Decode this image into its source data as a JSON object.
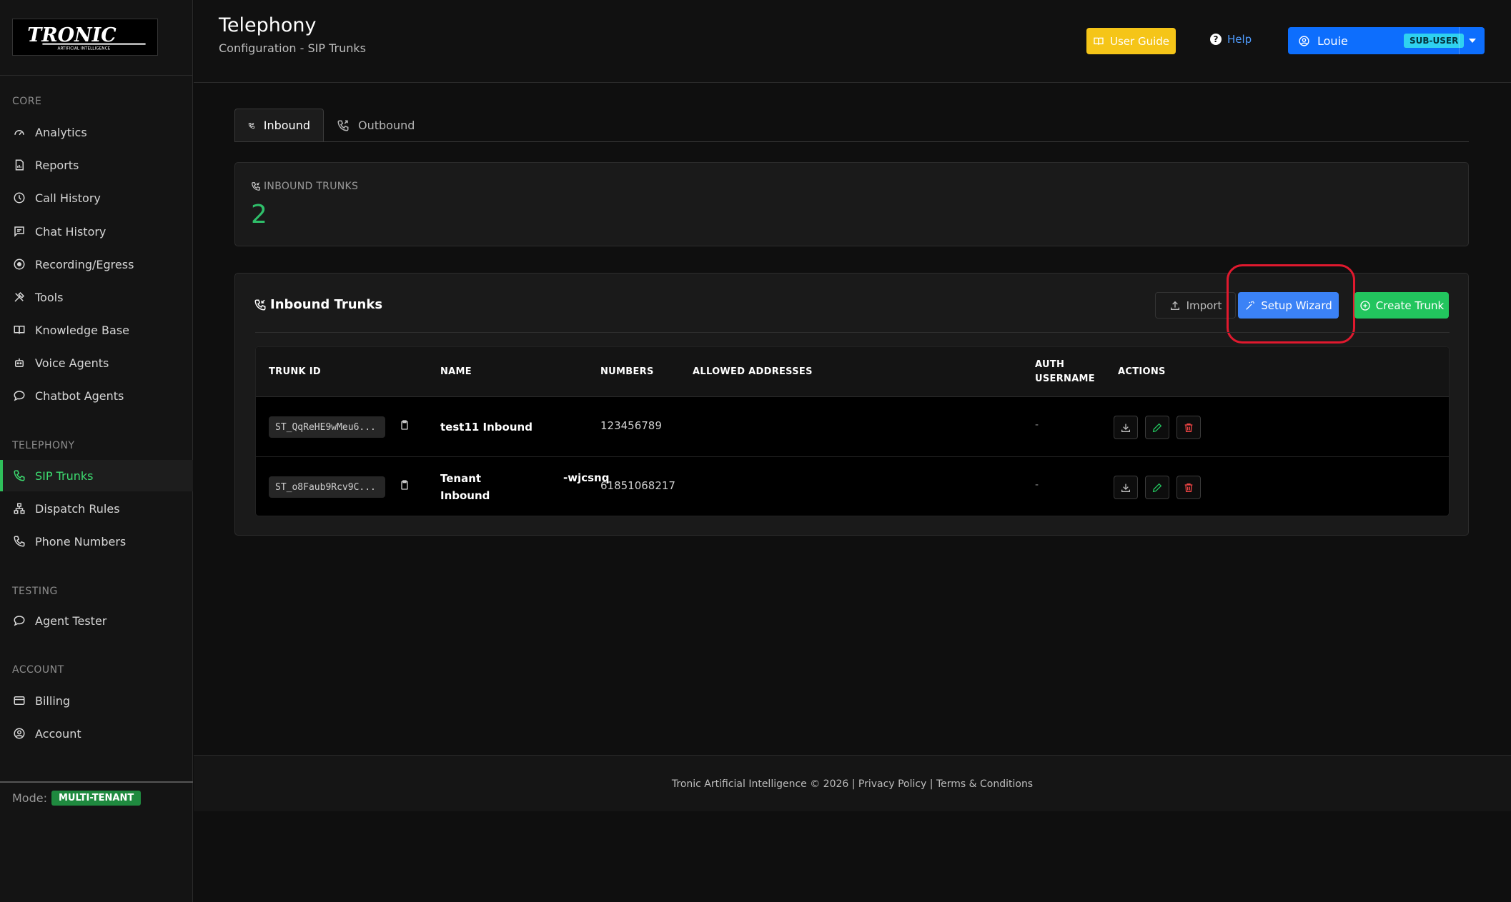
{
  "brand": {
    "logo_text": "TRONIC",
    "logo_sub": "ARTIFICIAL INTELLIGENCE"
  },
  "sidebar": {
    "sections": [
      {
        "label": "CORE",
        "items": [
          {
            "label": "Analytics",
            "icon": "gauge-icon"
          },
          {
            "label": "Reports",
            "icon": "report-icon"
          },
          {
            "label": "Call History",
            "icon": "clock-icon"
          },
          {
            "label": "Chat History",
            "icon": "chat-icon"
          },
          {
            "label": "Recording/Egress",
            "icon": "record-icon"
          },
          {
            "label": "Tools",
            "icon": "tools-icon"
          },
          {
            "label": "Knowledge Base",
            "icon": "book-icon"
          },
          {
            "label": "Voice Agents",
            "icon": "robot-icon"
          },
          {
            "label": "Chatbot Agents",
            "icon": "chat-bubble-icon"
          }
        ]
      },
      {
        "label": "TELEPHONY",
        "items": [
          {
            "label": "SIP Trunks",
            "icon": "phone-icon",
            "active": true
          },
          {
            "label": "Dispatch Rules",
            "icon": "hierarchy-icon"
          },
          {
            "label": "Phone Numbers",
            "icon": "phone-icon"
          }
        ]
      },
      {
        "label": "TESTING",
        "items": [
          {
            "label": "Agent Tester",
            "icon": "chat-bubble-icon"
          }
        ]
      },
      {
        "label": "ACCOUNT",
        "items": [
          {
            "label": "Billing",
            "icon": "card-icon"
          },
          {
            "label": "Account",
            "icon": "user-circle-icon"
          }
        ]
      }
    ],
    "mode_label": "Mode:",
    "mode_value": "MULTI-TENANT"
  },
  "header": {
    "title": "Telephony",
    "subtitle": "Configuration - SIP Trunks",
    "user_guide": "User Guide",
    "help": "Help",
    "user_name": "Louie",
    "user_role": "SUB-USER"
  },
  "tabs": [
    {
      "label": "Inbound",
      "active": true
    },
    {
      "label": "Outbound",
      "active": false
    }
  ],
  "stat": {
    "label": "INBOUND TRUNKS",
    "value": "2"
  },
  "table_card": {
    "title": "Inbound Trunks",
    "import": "Import",
    "setup_wizard": "Setup Wizard",
    "create_trunk": "Create Trunk",
    "columns": [
      "TRUNK ID",
      "NAME",
      "NUMBERS",
      "ALLOWED ADDRESSES",
      "AUTH USERNAME",
      "ACTIONS"
    ],
    "rows": [
      {
        "id": "ST_QqReHE9wMeu6...",
        "name_line1": "test11 Inbound",
        "name_line2": "",
        "name_suffix": "",
        "numbers": "123456789",
        "allowed": "",
        "auth": "-"
      },
      {
        "id": "ST_o8Faub9Rcv9C...",
        "name_line1": "Tenant",
        "name_line2": "Inbound",
        "name_suffix": "-wjcsnq",
        "numbers": "61851068217",
        "allowed": "",
        "auth": "-"
      }
    ]
  },
  "footer": {
    "text": "Tronic Artificial Intelligence © 2026 | Privacy Policy | Terms & Conditions"
  },
  "colors": {
    "accent_green": "#2fbf6a",
    "primary_blue": "#3b82f6",
    "guide_yellow": "#f5c518",
    "highlight_red": "#e0192e"
  }
}
